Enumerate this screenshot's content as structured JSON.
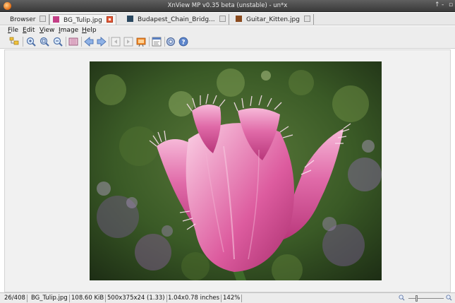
{
  "window": {
    "title": "XnView MP v0.35 beta (unstable) - un*x"
  },
  "tabs": [
    {
      "label": "Browser",
      "active": false
    },
    {
      "label": "BG_Tulip.jpg",
      "active": true
    },
    {
      "label": "Budapest_Chain_Bridg...",
      "active": false
    },
    {
      "label": "Guitar_Kitten.jpg",
      "active": false
    }
  ],
  "menu": [
    "File",
    "Edit",
    "View",
    "Image",
    "Help"
  ],
  "toolbar": [
    "browser-icon",
    "zoom-in-icon",
    "zoom-fit-icon",
    "zoom-out-icon",
    "fullscreen-icon",
    "previous-icon",
    "next-icon",
    "first-page-icon",
    "last-page-icon",
    "slideshow-icon",
    "properties-icon",
    "settings-icon",
    "help-icon"
  ],
  "image": {
    "subject": "pink fringed tulip"
  },
  "status": {
    "index": "26/408",
    "filename": "BG_Tulip.jpg",
    "filesize": "108.60 KiB",
    "dimensions": "500x375x24 (1.33)",
    "print_size": "1.04x0.78 inches",
    "zoom": "142%"
  },
  "colors": {
    "titlebar": "#4a4a4a",
    "close_tab": "#e25a3a",
    "tulip": "#d94f97"
  }
}
